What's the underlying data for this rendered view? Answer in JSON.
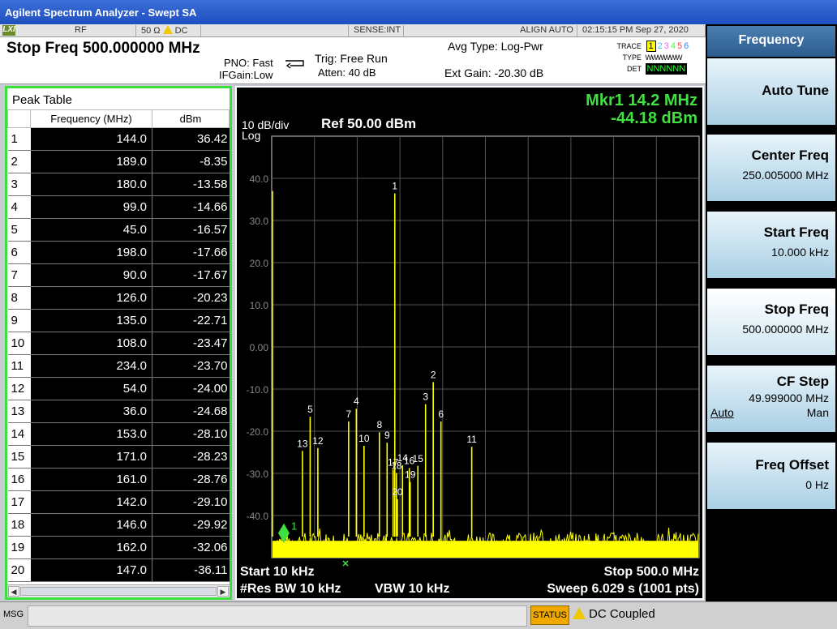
{
  "window": {
    "title": "Agilent Spectrum Analyzer - Swept SA"
  },
  "strip": {
    "logo": "LXI",
    "rf": "RF",
    "impedance": "50 Ω",
    "coupling": "DC",
    "sense": "SENSE:INT",
    "align": "ALIGN AUTO",
    "datetime": "02:15:15 PM Sep 27, 2020"
  },
  "header": {
    "title": "Stop Freq 500.000000 MHz",
    "pno": "PNO: Fast",
    "ifgain": "IFGain:Low",
    "trig": "Trig: Free Run",
    "atten": "Atten: 40 dB",
    "avg_type": "Avg Type: Log-Pwr",
    "ext_gain": "Ext Gain: -20.30 dB",
    "trace_label": "TRACE",
    "type_label": "TYPE",
    "det_label": "DET",
    "trace_nums": [
      "1",
      "2",
      "3",
      "4",
      "5",
      "6"
    ],
    "trace_colors": [
      "#ffff00",
      "#40c0ff",
      "#ff60ff",
      "#40ff40",
      "#ff4040",
      "#4080ff"
    ],
    "type_val": "WWWWWW",
    "det_val": "NNNNNN"
  },
  "peak_table": {
    "title": "Peak Table",
    "col_freq": "Frequency (MHz)",
    "col_dbm": "dBm",
    "rows": [
      {
        "i": "1",
        "f": "144.0",
        "d": "36.42"
      },
      {
        "i": "2",
        "f": "189.0",
        "d": "-8.35"
      },
      {
        "i": "3",
        "f": "180.0",
        "d": "-13.58"
      },
      {
        "i": "4",
        "f": "99.0",
        "d": "-14.66"
      },
      {
        "i": "5",
        "f": "45.0",
        "d": "-16.57"
      },
      {
        "i": "6",
        "f": "198.0",
        "d": "-17.66"
      },
      {
        "i": "7",
        "f": "90.0",
        "d": "-17.67"
      },
      {
        "i": "8",
        "f": "126.0",
        "d": "-20.23"
      },
      {
        "i": "9",
        "f": "135.0",
        "d": "-22.71"
      },
      {
        "i": "10",
        "f": "108.0",
        "d": "-23.47"
      },
      {
        "i": "11",
        "f": "234.0",
        "d": "-23.70"
      },
      {
        "i": "12",
        "f": "54.0",
        "d": "-24.00"
      },
      {
        "i": "13",
        "f": "36.0",
        "d": "-24.68"
      },
      {
        "i": "14",
        "f": "153.0",
        "d": "-28.10"
      },
      {
        "i": "15",
        "f": "171.0",
        "d": "-28.23"
      },
      {
        "i": "16",
        "f": "161.0",
        "d": "-28.76"
      },
      {
        "i": "17",
        "f": "142.0",
        "d": "-29.10"
      },
      {
        "i": "18",
        "f": "146.0",
        "d": "-29.92"
      },
      {
        "i": "19",
        "f": "162.0",
        "d": "-32.06"
      },
      {
        "i": "20",
        "f": "147.0",
        "d": "-36.11"
      }
    ]
  },
  "graph": {
    "scale": "10 dB/div",
    "log": "Log",
    "ref": "Ref 50.00 dBm",
    "marker_line1": "Mkr1 14.2 MHz",
    "marker_line2": "-44.18 dBm",
    "marker_label": "1",
    "start": "Start 10 kHz",
    "stop": "Stop 500.0 MHz",
    "rbw": "#Res BW 10 kHz",
    "vbw": "VBW 10 kHz",
    "sweep": "Sweep  6.029 s (1001 pts)",
    "y_ticks": [
      "40.0",
      "30.0",
      "20.0",
      "10.0",
      "0.00",
      "-10.0",
      "-20.0",
      "-30.0",
      "-40.0"
    ],
    "trace_color": "#ffff00",
    "marker_color": "#40e040"
  },
  "chart_data": {
    "type": "line",
    "xlabel": "",
    "ylabel": "",
    "xlim": [
      0.01,
      500.0
    ],
    "ylim": [
      -50,
      50
    ],
    "grid": true,
    "noise_floor": -45,
    "marker": {
      "x": 14.2,
      "y": -44.18
    },
    "series": [
      {
        "x": [
          144.0,
          189.0,
          180.0,
          99.0,
          45.0,
          198.0,
          90.0,
          126.0,
          135.0,
          108.0,
          234.0,
          54.0,
          36.0,
          153.0,
          171.0,
          161.0,
          142.0,
          146.0,
          162.0,
          147.0
        ],
        "values": [
          36.42,
          -8.35,
          -13.58,
          -14.66,
          -16.57,
          -17.66,
          -17.67,
          -20.23,
          -22.71,
          -23.47,
          -23.7,
          -24.0,
          -24.68,
          -28.1,
          -28.23,
          -28.76,
          -29.1,
          -29.92,
          -32.06,
          -36.11
        ]
      }
    ]
  },
  "softkeys": {
    "menu_title": "Frequency",
    "auto_tune": "Auto Tune",
    "center_label": "Center Freq",
    "center_val": "250.005000 MHz",
    "start_label": "Start Freq",
    "start_val": "10.000 kHz",
    "stop_label": "Stop Freq",
    "stop_val": "500.000000 MHz",
    "cf_label": "CF Step",
    "cf_val": "49.999000 MHz",
    "cf_auto": "Auto",
    "cf_man": "Man",
    "offset_label": "Freq Offset",
    "offset_val": "0 Hz"
  },
  "bottom": {
    "msg": "MSG",
    "status": "STATUS",
    "dc": "DC Coupled"
  }
}
